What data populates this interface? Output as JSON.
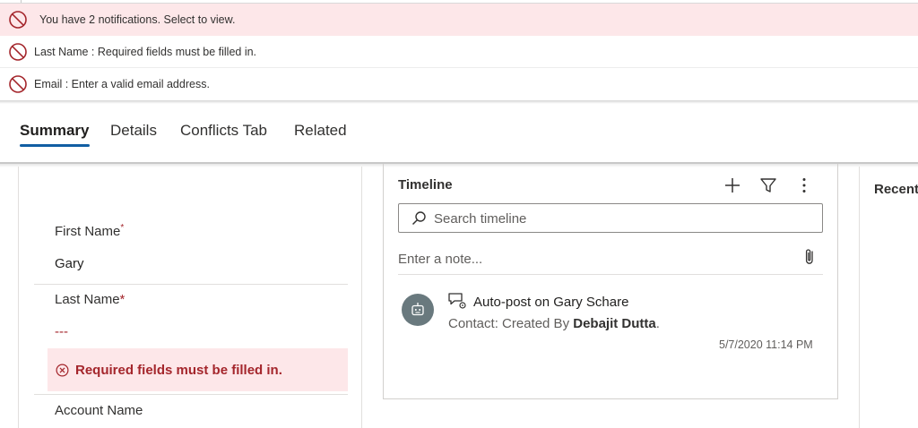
{
  "notifications": {
    "summary": "You have 2 notifications. Select to view.",
    "items": [
      "Last Name : Required fields must be filled in.",
      "Email : Enter a valid email address."
    ]
  },
  "tabs": [
    "Summary",
    "Details",
    "Conflicts Tab",
    "Related"
  ],
  "form": {
    "first_name_label": "First Name",
    "required_marker": "*",
    "first_name_value": "Gary",
    "last_name_label": "Last Name",
    "last_name_value": "---",
    "last_name_error": "Required fields must be filled in.",
    "account_name_label": "Account Name"
  },
  "timeline": {
    "title": "Timeline",
    "search_placeholder": "Search timeline",
    "note_placeholder": "Enter a note...",
    "post": {
      "title": "Auto-post on Gary Schare",
      "subtitle_prefix": "Contact: Created By ",
      "subtitle_author": "Debajit Dutta",
      "subtitle_suffix": ".",
      "timestamp": "5/7/2020 11:14 PM"
    }
  },
  "recent": {
    "title": "Recent"
  },
  "colors": {
    "error": "#a4262c",
    "error_bg": "#fde7e9",
    "accent": "#115ea3"
  }
}
